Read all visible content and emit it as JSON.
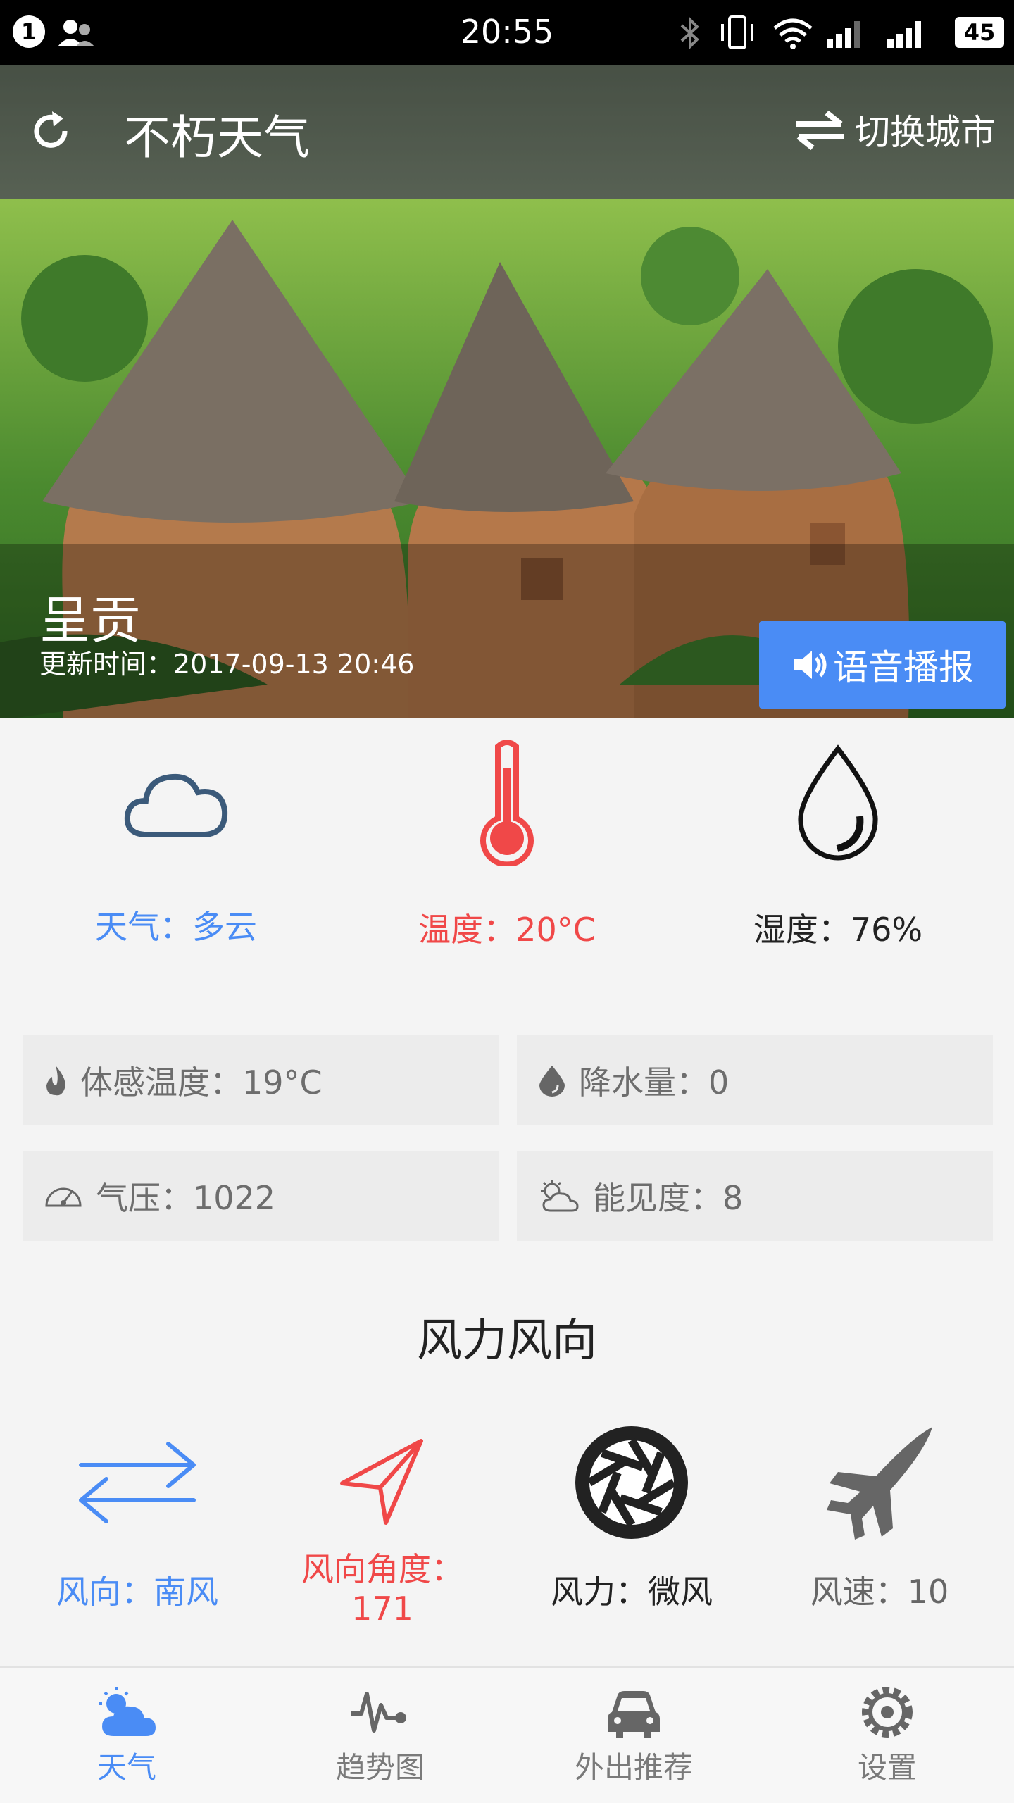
{
  "status_bar": {
    "time": "20:55",
    "notification_count": "1",
    "battery": "45"
  },
  "header": {
    "title": "不朽天气",
    "switch_city": "切换城市"
  },
  "hero": {
    "city": "呈贡",
    "updated": "更新时间：2017-09-13 20:46",
    "voice_button": "语音播报"
  },
  "metrics": [
    {
      "label": "天气：多云",
      "icon": "cloud-icon",
      "color": "#4a8cf5"
    },
    {
      "label": "温度：20°C",
      "icon": "thermometer-icon",
      "color": "#f04848"
    },
    {
      "label": "湿度：76%",
      "icon": "drop-icon",
      "color": "#222222"
    }
  ],
  "details": {
    "feels_like": "体感温度：19°C",
    "precip": "降水量：0",
    "pressure": "气压：1022",
    "visibility": "能见度：8"
  },
  "wind": {
    "section_title": "风力风向",
    "direction": "风向：南风",
    "angle_label": "风向角度：",
    "angle_value": "171",
    "force": "风力：微风",
    "speed": "风速：10"
  },
  "nav": [
    {
      "label": "天气",
      "icon": "weather-icon"
    },
    {
      "label": "趋势图",
      "icon": "trend-icon"
    },
    {
      "label": "外出推荐",
      "icon": "car-icon"
    },
    {
      "label": "设置",
      "icon": "gear-icon"
    }
  ],
  "colors": {
    "accent": "#4a8cf5",
    "red": "#f04848",
    "dark": "#222222",
    "gray": "#6d6d6d"
  }
}
